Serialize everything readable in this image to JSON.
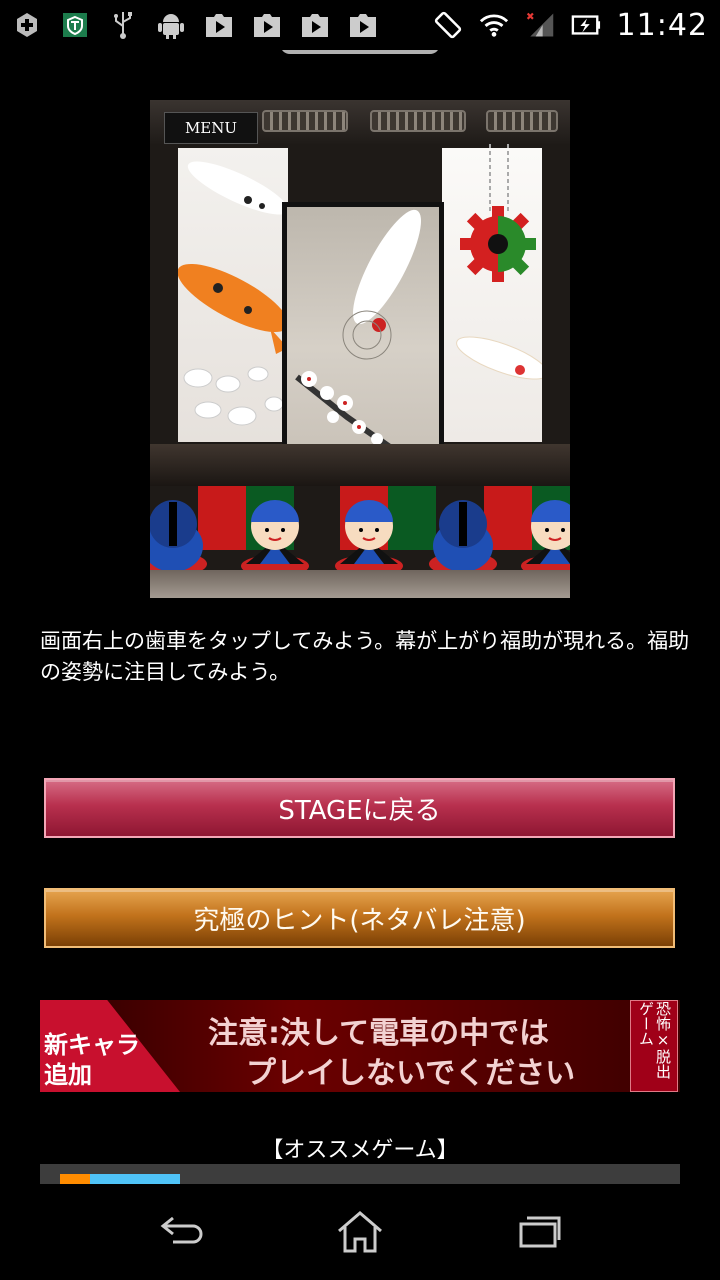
{
  "status_bar": {
    "time": "11:42",
    "left_icons": [
      "add-icon",
      "shield-icon",
      "usb-icon",
      "android-icon",
      "play-icon",
      "play-icon",
      "play-icon",
      "play-icon"
    ],
    "right_icons": [
      "rotate-icon",
      "wifi-icon",
      "signal-icon",
      "battery-icon"
    ]
  },
  "game_preview": {
    "menu_label": "MENU"
  },
  "hint": {
    "text": "画面右上の歯車をタップしてみよう。幕が上がり福助が現れる。福助の姿勢に注目してみよう。"
  },
  "buttons": {
    "back_to_stage": "STAGEに戻る",
    "ultimate_hint": "究極のヒント(ネタバレ注意)"
  },
  "banner": {
    "corner_text": "新キャラ追加",
    "line1": "注意:決して電車の中では",
    "line2": "プレイしないでください",
    "side_text": "恐怖×脱出ゲーム"
  },
  "recommend": {
    "title": "【オススメゲーム】"
  },
  "nav": {
    "icons": [
      "back-icon",
      "home-icon",
      "recents-icon"
    ]
  },
  "colors": {
    "stage_button": "#b8304e",
    "hint_button": "#c2731c",
    "banner_red": "#c8102e"
  }
}
